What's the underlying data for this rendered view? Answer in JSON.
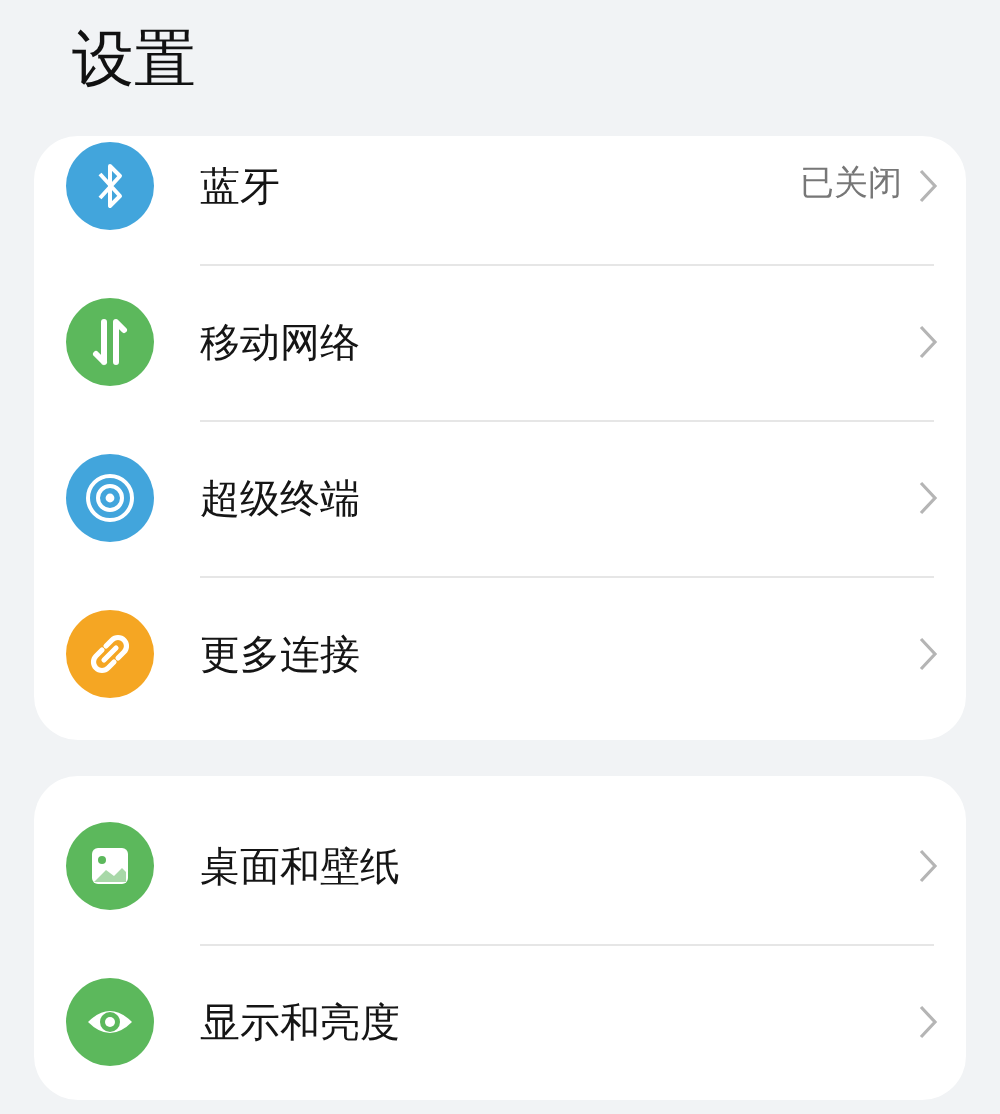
{
  "title": "设置",
  "groups": [
    {
      "items": [
        {
          "kind": "bluetooth",
          "label": "蓝牙",
          "value": "已关闭"
        },
        {
          "kind": "mobile-data",
          "label": "移动网络"
        },
        {
          "kind": "super-device",
          "label": "超级终端"
        },
        {
          "kind": "link",
          "label": "更多连接"
        }
      ]
    },
    {
      "items": [
        {
          "kind": "wallpaper",
          "label": "桌面和壁纸"
        },
        {
          "kind": "display",
          "label": "显示和亮度"
        }
      ]
    }
  ]
}
